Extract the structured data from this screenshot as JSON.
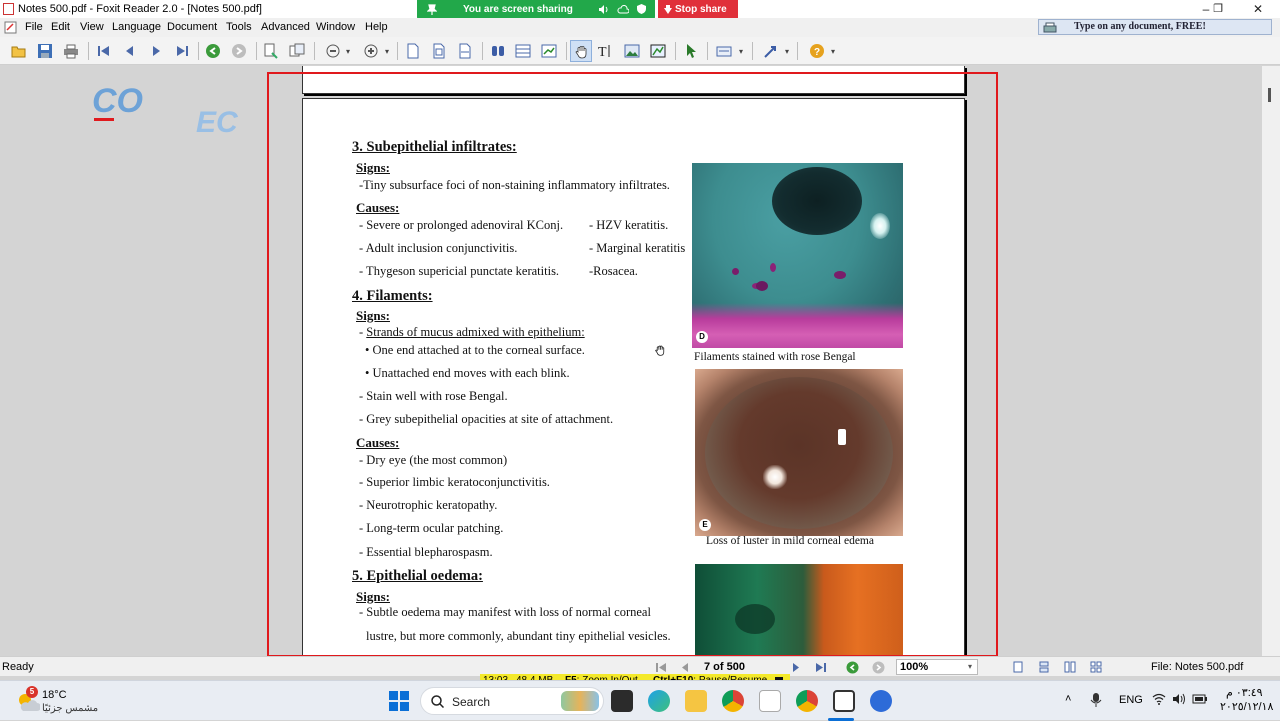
{
  "window": {
    "title": "Notes 500.pdf - Foxit Reader 2.0 - [Notes 500.pdf]",
    "controls": [
      "–",
      "❐",
      "✕"
    ]
  },
  "sharing": {
    "status": "You are screen sharing",
    "stop_label": "Stop share"
  },
  "menu": {
    "items": [
      "File",
      "Edit",
      "View",
      "Language",
      "Document",
      "Tools",
      "Advanced",
      "Window",
      "Help"
    ],
    "ad_text": "Type on any document, FREE!"
  },
  "watermark": {
    "text1": "CO",
    "text2": "EC"
  },
  "document": {
    "section3": {
      "heading": "3. Subepithelial infiltrates:",
      "signs_label": "Signs:",
      "signs": [
        "-Tiny subsurface foci of non-staining inflammatory infiltrates."
      ],
      "causes_label": "Causes:",
      "causes_left": [
        "- Severe or prolonged adenoviral KConj.",
        "- Adult inclusion conjunctivitis.",
        "- Thygeson supericial punctate keratitis."
      ],
      "causes_right": [
        "- HZV keratitis.",
        "- Marginal keratitis",
        "-Rosacea."
      ]
    },
    "section4": {
      "heading": "4. Filaments:",
      "signs_label": "Signs:",
      "sign_main": "Strands of mucus admixed with epithelium:",
      "sign_prefix": "- ",
      "bullets": [
        "• One end attached at to the corneal surface.",
        "• Unattached end moves with each blink."
      ],
      "signs_more": [
        "- Stain well with rose Bengal.",
        "- Grey subepithelial opacities at site of attachment."
      ],
      "causes_label": "Causes:",
      "causes": [
        "- Dry eye (the most common)",
        "- Superior limbic keratoconjunctivitis.",
        "- Neurotrophic keratopathy.",
        "- Long-term ocular patching.",
        "- Essential blepharospasm."
      ]
    },
    "section5": {
      "heading": "5. Epithelial oedema:",
      "signs_label": "Signs:",
      "lines": [
        "- Subtle oedema may manifest with loss of normal corneal",
        "lustre, but more commonly, abundant tiny epithelial vesicles."
      ]
    },
    "figures": [
      {
        "label": "D",
        "caption": "Filaments stained with rose Bengal"
      },
      {
        "label": "E",
        "caption": "Loss of luster in mild corneal edema"
      }
    ]
  },
  "status": {
    "ready": "Ready",
    "page": "7 of 500",
    "zoom": "100%",
    "file": "File: Notes 500.pdf"
  },
  "recorder": {
    "time": "13:03",
    "size": "48.4 MB",
    "zoom_hint_key": "F5",
    "zoom_hint": ": Zoom In/Out",
    "pause_key": "Ctrl+F10",
    "pause_hint": ": Pause/Resume"
  },
  "taskbar": {
    "weather_temp": "18°C",
    "weather_desc": "مشمس جزئيًا",
    "weather_badge": "5",
    "search_label": "Search",
    "lang": "ENG",
    "time": "٠٣:٤٩ م",
    "date": "٢٠٢٥/١٢/١٨"
  }
}
